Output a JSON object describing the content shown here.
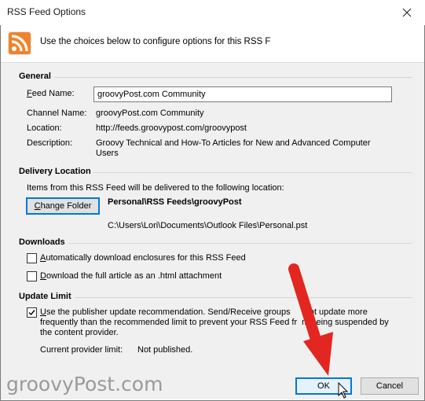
{
  "window": {
    "title": "RSS Feed Options",
    "header_text": "Use the choices below to configure options for this RSS F"
  },
  "general": {
    "heading": "General",
    "feed_name_label_pre": "F",
    "feed_name_label_post": "eed Name:",
    "feed_name_value": "groovyPost.com Community",
    "channel_name_label": "Channel Name:",
    "channel_name_value": "groovyPost.com Community",
    "location_label": "Location:",
    "location_value": "http://feeds.groovypost.com/groovypost",
    "description_label": "Description:",
    "description_line1": "Groovy Technical and How-To Articles for New and Advanced Computer",
    "description_line2": "Users"
  },
  "delivery": {
    "heading": "Delivery Location",
    "intro": "Items from this RSS Feed will be delivered to the following location:",
    "change_folder_pre": "C",
    "change_folder_post": "hange Folder",
    "folder_path": "Personal\\RSS Feeds\\groovyPost",
    "file_path": "C:\\Users\\Lori\\Documents\\Outlook Files\\Personal.pst"
  },
  "downloads": {
    "heading": "Downloads",
    "auto_download_pre": "A",
    "auto_download_post": "utomatically download enclosures for this RSS Feed",
    "auto_download_checked": false,
    "full_article_pre": "D",
    "full_article_post": "ownload the full article as an .html attachment",
    "full_article_checked": false
  },
  "update_limit": {
    "heading": "Update Limit",
    "publisher_line1_pre": "U",
    "publisher_line1_post": "se the publisher update recommendation. Send/Receive groups ",
    "publisher_line1_tail": " not update more",
    "publisher_line2": "frequently than the recommended limit to prevent your RSS Feed fr",
    "publisher_line2_tail": "m being suspended by",
    "publisher_line3": "the content provider.",
    "publisher_checked": true,
    "provider_limit_label": "Current provider limit:",
    "provider_limit_value": "Not published."
  },
  "buttons": {
    "ok": "OK",
    "cancel": "Cancel"
  },
  "watermark": "groovyPost.com",
  "colors": {
    "accent": "#0078d7",
    "arrow": "#e3261f",
    "rss_orange": "#f0832a"
  }
}
